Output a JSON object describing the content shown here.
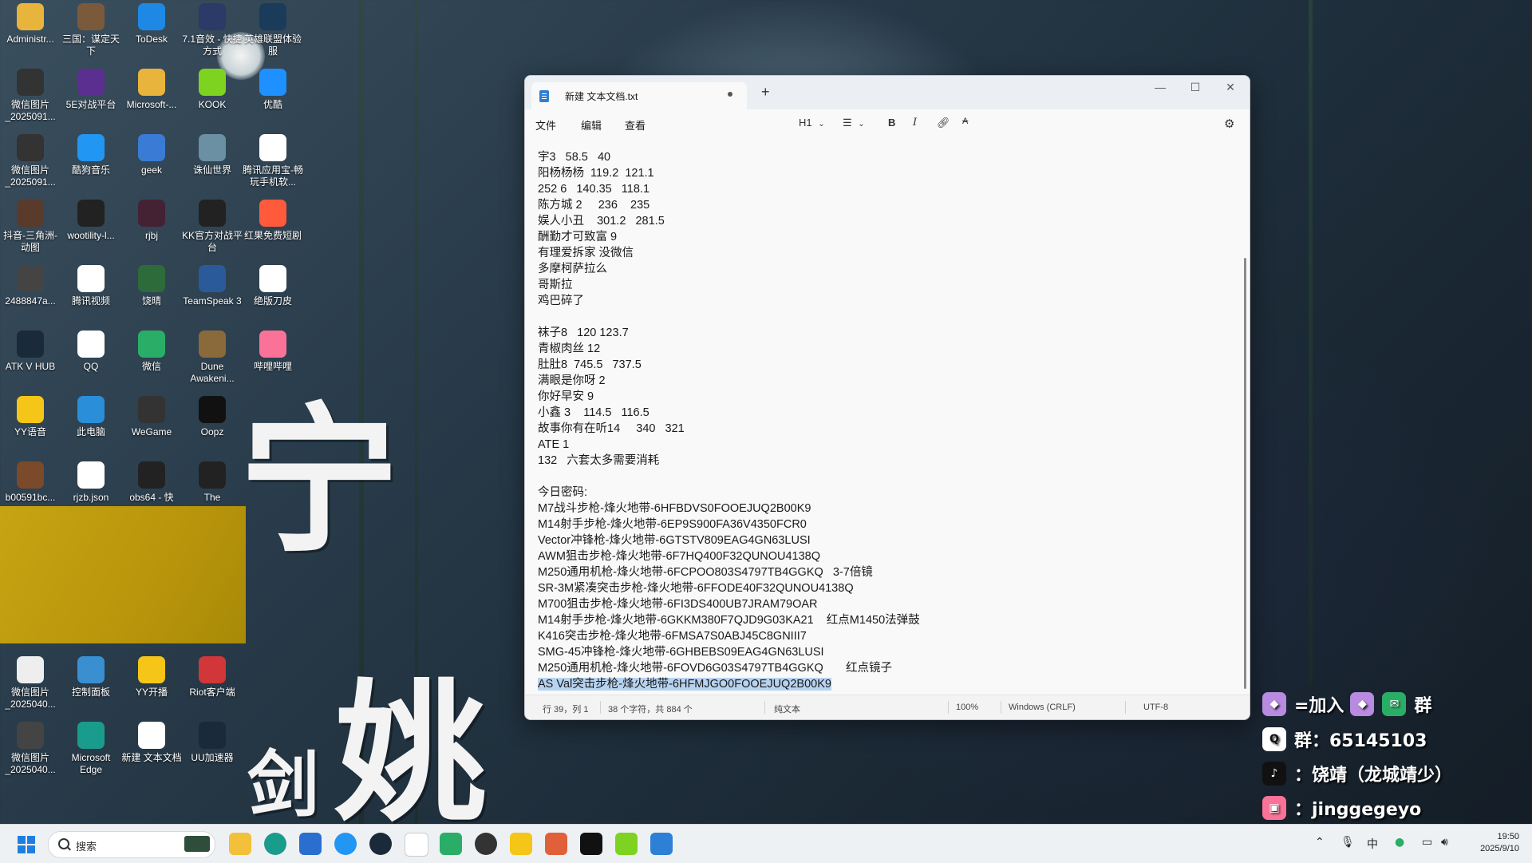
{
  "desktop": {
    "icons": [
      {
        "label": "Administr...",
        "glyph": "folder-icon",
        "color": "#e8b43c"
      },
      {
        "label": "三国：谋定天下",
        "glyph": "game-icon",
        "color": "#7a5a3a"
      },
      {
        "label": "ToDesk",
        "glyph": "todesk-icon",
        "color": "#1e88e5"
      },
      {
        "label": "7.1音效 - 快捷方式",
        "glyph": "audio-icon",
        "color": "#2b3a67"
      },
      {
        "label": "英雄联盟体验服",
        "glyph": "lol-icon",
        "color": "#1b3b5a"
      },
      {
        "label": "微信图片_2025091...",
        "glyph": "image-icon",
        "color": "#333333"
      },
      {
        "label": "5E对战平台",
        "glyph": "5e-icon",
        "color": "#5a2f8f"
      },
      {
        "label": "Microsoft-...",
        "glyph": "folder-icon",
        "color": "#e8b43c"
      },
      {
        "label": "KOOK",
        "glyph": "kook-icon",
        "color": "#7ed321"
      },
      {
        "label": "优酷",
        "glyph": "youku-icon",
        "color": "#1e90ff"
      },
      {
        "label": "微信图片_2025091...",
        "glyph": "image-icon",
        "color": "#333333"
      },
      {
        "label": "酷狗音乐",
        "glyph": "kugou-icon",
        "color": "#2196f3"
      },
      {
        "label": "geek",
        "glyph": "geek-icon",
        "color": "#3a7bd5"
      },
      {
        "label": "诛仙世界",
        "glyph": "zhuxian-icon",
        "color": "#6b8fa3"
      },
      {
        "label": "腾讯应用宝-畅玩手机软...",
        "glyph": "yyb-icon",
        "color": "#ffffff"
      },
      {
        "label": "抖音-三角洲-动图",
        "glyph": "image-icon",
        "color": "#5a3a2a"
      },
      {
        "label": "wootility-l...",
        "glyph": "wooting-icon",
        "color": "#222222"
      },
      {
        "label": "rjbj",
        "glyph": "file-icon",
        "color": "#442233"
      },
      {
        "label": "KK官方对战平台",
        "glyph": "kk-icon",
        "color": "#222222"
      },
      {
        "label": "红果免费短剧",
        "glyph": "hongguo-icon",
        "color": "#ff5a3c"
      },
      {
        "label": "2488847a...",
        "glyph": "image-icon",
        "color": "#444444"
      },
      {
        "label": "腾讯视频",
        "glyph": "tencent-video-icon",
        "color": "#ffffff"
      },
      {
        "label": "饶晴",
        "glyph": "image-icon",
        "color": "#2d6b3a"
      },
      {
        "label": "TeamSpeak 3",
        "glyph": "teamspeak-icon",
        "color": "#2a5a9a"
      },
      {
        "label": "绝版刀皮",
        "glyph": "image-icon",
        "color": "#ffffff"
      },
      {
        "label": "ATK V HUB",
        "glyph": "atk-icon",
        "color": "#1a2a3a"
      },
      {
        "label": "QQ",
        "glyph": "qq-icon",
        "color": "#ffffff"
      },
      {
        "label": "微信",
        "glyph": "wechat-icon",
        "color": "#2aae67"
      },
      {
        "label": "Dune Awakeni...",
        "glyph": "dune-icon",
        "color": "#8a6a3a"
      },
      {
        "label": "哔哩哔哩",
        "glyph": "bilibili-icon",
        "color": "#fb7299"
      },
      {
        "label": "YY语音",
        "glyph": "yy-icon",
        "color": "#f5c518"
      },
      {
        "label": "此电脑",
        "glyph": "computer-icon",
        "color": "#2a8fd8"
      },
      {
        "label": "WeGame",
        "glyph": "wegame-icon",
        "color": "#333333"
      },
      {
        "label": "Oopz",
        "glyph": "oopz-icon",
        "color": "#111111"
      },
      {
        "label": "b00591bc...",
        "glyph": "image-icon",
        "color": "#7a4a2a"
      },
      {
        "label": "rjzb.json",
        "glyph": "file-icon",
        "color": "#ffffff"
      },
      {
        "label": "obs64 - 快",
        "glyph": "obs-icon",
        "color": "#222222"
      },
      {
        "label": "The",
        "glyph": "game-icon",
        "color": "#222222"
      },
      {
        "label": "微信图片_2025040...",
        "glyph": "image-icon",
        "color": "#eeeeee"
      },
      {
        "label": "控制面板",
        "glyph": "control-panel-icon",
        "color": "#3a8fd0"
      },
      {
        "label": "YY开播",
        "glyph": "yy-live-icon",
        "color": "#f5c518"
      },
      {
        "label": "Riot客户端",
        "glyph": "riot-icon",
        "color": "#d13639"
      },
      {
        "label": "微信图片_2025040...",
        "glyph": "image-icon",
        "color": "#444444"
      },
      {
        "label": "Microsoft Edge",
        "glyph": "edge-icon",
        "color": "#1a9c8c"
      },
      {
        "label": "新建 文本文档",
        "glyph": "text-file-icon",
        "color": "#ffffff"
      },
      {
        "label": "UU加速器",
        "glyph": "uu-icon",
        "color": "#1a2a3a"
      }
    ]
  },
  "notepad": {
    "tab_title": "新建 文本文档.txt",
    "menu": [
      "文件",
      "编辑",
      "查看"
    ],
    "toolbar": {
      "heading": "H1",
      "bold": "B",
      "italic": "I"
    },
    "lines": [
      "宇3   58.5   40",
      "阳杨杨杨  119.2  121.1",
      "252 6   140.35   118.1",
      "陈方城 2     236    235",
      "娱人小丑    301.2   281.5",
      "酬勤才可致富 9",
      "有理爱拆家 没微信",
      "多摩柯萨拉么",
      "哥斯拉",
      "鸡巴碎了",
      "",
      "袜子8   120 123.7",
      "青椒肉丝 12",
      "肚肚8  745.5   737.5",
      "满眼是你呀 2",
      "你好早安 9",
      "小鑫 3    114.5   116.5",
      "故事你有在听14     340   321",
      "ATE 1",
      "132   六套太多需要消耗",
      "",
      "今日密码:",
      "M7战斗步枪-烽火地带-6HFBDVS0FOOEJUQ2B00K9",
      "M14射手步枪-烽火地带-6EP9S900FA36V4350FCR0",
      "Vector冲锋枪-烽火地带-6GTSTV809EAG4GN63LUSI",
      "AWM狙击步枪-烽火地带-6F7HQ400F32QUNOU4138Q",
      "M250通用机枪-烽火地带-6FCPOO803S4797TB4GGKQ   3-7倍镜",
      "SR-3M紧凑突击步枪-烽火地带-6FFODE40F32QUNOU4138Q",
      "M700狙击步枪-烽火地带-6FI3DS400UB7JRAM79OAR",
      "M14射手步枪-烽火地带-6GKKM380F7QJD9G03KA21    红点M1450法弹鼓",
      "K416突击步枪-烽火地带-6FMSA7S0ABJ45C8GNIII7",
      "SMG-45冲锋枪-烽火地带-6GHBEBS09EAG4GN63LUSI",
      "M250通用机枪-烽火地带-6FOVD6G03S4797TB4GGKQ       红点镜子",
      "AS Val突击步枪-烽火地带-6HFMJGO0FOOEJUQ2B00K9"
    ],
    "selected_line": 33,
    "status": {
      "position": "行 39，列 1",
      "chars": "38 个字符，共 884 个",
      "format": "纯文本",
      "zoom": "100%",
      "line_ending": "Windows (CRLF)",
      "encoding": "UTF-8"
    }
  },
  "calligraphy": [
    "宁",
    "姚",
    "剑"
  ],
  "promo": {
    "join_text": "=加入",
    "group_label": "群",
    "qq_group": "群：65145103",
    "douyin": "：饶靖（龙城靖少）",
    "bilibili": "：jinggegeyo"
  },
  "taskbar": {
    "search_label": "搜索",
    "ime": "中",
    "time": "19:50",
    "date": "2025/9/10"
  }
}
